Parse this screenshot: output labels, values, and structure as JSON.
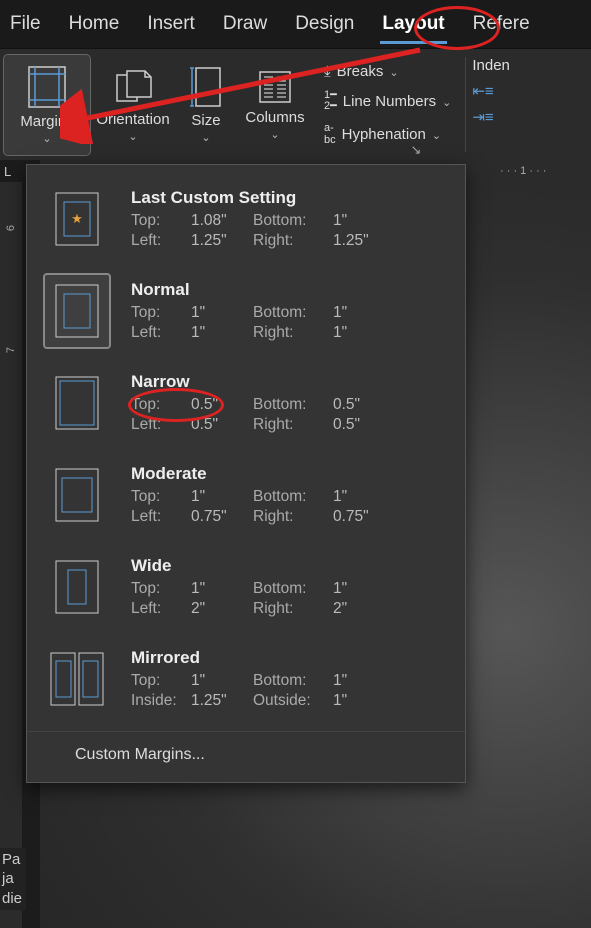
{
  "tabs": {
    "file": "File",
    "home": "Home",
    "insert": "Insert",
    "draw": "Draw",
    "design": "Design",
    "layout": "Layout",
    "references": "Refere"
  },
  "ribbon": {
    "margins": "Margins",
    "orientation": "Orientation",
    "size": "Size",
    "columns": "Columns",
    "breaks": "Breaks",
    "line_numbers": "Line Numbers",
    "hyphenation": "Hyphenation",
    "indent_label": "Inden"
  },
  "ruler": {
    "h": "1",
    "v": [
      "6",
      "7"
    ],
    "corner": "L"
  },
  "left_frag": [
    "Pa",
    "ja",
    "die"
  ],
  "dropdown": {
    "items": [
      {
        "title": "Last Custom Setting",
        "l1k": "Top:",
        "l1v": "1.08\"",
        "r1k": "Bottom:",
        "r1v": "1\"",
        "l2k": "Left:",
        "l2v": "1.25\"",
        "r2k": "Right:",
        "r2v": "1.25\""
      },
      {
        "title": "Normal",
        "l1k": "Top:",
        "l1v": "1\"",
        "r1k": "Bottom:",
        "r1v": "1\"",
        "l2k": "Left:",
        "l2v": "1\"",
        "r2k": "Right:",
        "r2v": "1\""
      },
      {
        "title": "Narrow",
        "l1k": "Top:",
        "l1v": "0.5\"",
        "r1k": "Bottom:",
        "r1v": "0.5\"",
        "l2k": "Left:",
        "l2v": "0.5\"",
        "r2k": "Right:",
        "r2v": "0.5\""
      },
      {
        "title": "Moderate",
        "l1k": "Top:",
        "l1v": "1\"",
        "r1k": "Bottom:",
        "r1v": "1\"",
        "l2k": "Left:",
        "l2v": "0.75\"",
        "r2k": "Right:",
        "r2v": "0.75\""
      },
      {
        "title": "Wide",
        "l1k": "Top:",
        "l1v": "1\"",
        "r1k": "Bottom:",
        "r1v": "1\"",
        "l2k": "Left:",
        "l2v": "2\"",
        "r2k": "Right:",
        "r2v": "2\""
      },
      {
        "title": "Mirrored",
        "l1k": "Top:",
        "l1v": "1\"",
        "r1k": "Bottom:",
        "r1v": "1\"",
        "l2k": "Inside:",
        "l2v": "1.25\"",
        "r2k": "Outside:",
        "r2v": "1\""
      }
    ],
    "footer": "Custom Margins..."
  }
}
